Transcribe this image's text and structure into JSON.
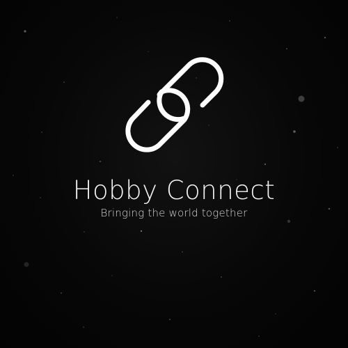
{
  "brand": {
    "title": "Hobby Connect",
    "tagline": "Bringing the world together",
    "logo_icon": "chain-link-icon"
  },
  "colors": {
    "background": "#050505",
    "foreground": "#ffffff"
  }
}
